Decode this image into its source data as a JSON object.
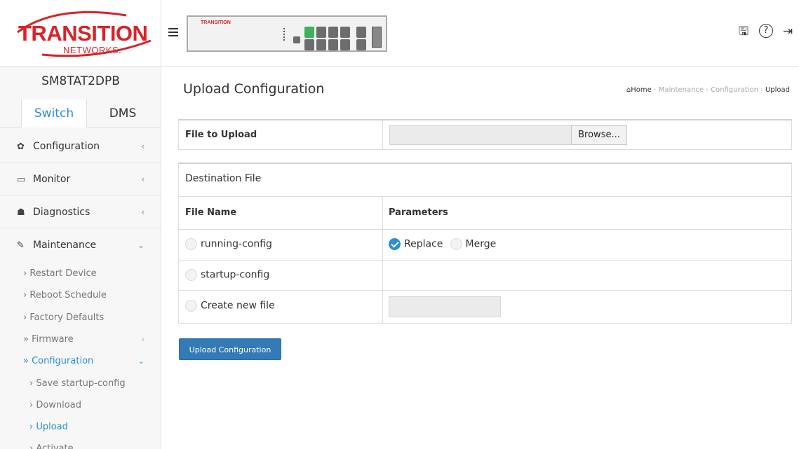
{
  "brand": {
    "logo_main": "TRANSITION",
    "logo_sub": "NETWORKS.",
    "panel_brand": "TRANSITION",
    "accent": "#d8232a"
  },
  "device_name": "SM8TAT2DPB",
  "tabs": [
    {
      "label": "Switch",
      "active": true
    },
    {
      "label": "DMS",
      "active": false
    }
  ],
  "nav": {
    "configuration": {
      "label": "Configuration",
      "icon": "gear-icon"
    },
    "monitor": {
      "label": "Monitor",
      "icon": "monitor-icon"
    },
    "diagnostics": {
      "label": "Diagnostics",
      "icon": "sitemap-icon"
    },
    "maintenance": {
      "label": "Maintenance",
      "icon": "wrench-icon"
    },
    "sub": [
      {
        "label": "Restart Device"
      },
      {
        "label": "Reboot Schedule"
      },
      {
        "label": "Factory Defaults"
      },
      {
        "label": "Firmware"
      },
      {
        "label": "Configuration"
      },
      {
        "label": "Save startup-config"
      },
      {
        "label": "Download"
      },
      {
        "label": "Upload"
      },
      {
        "label": "Activate"
      }
    ]
  },
  "topbar_icons": [
    "save-icon",
    "help-icon",
    "logout-icon"
  ],
  "page": {
    "title": "Upload Configuration",
    "breadcrumb": [
      "Home",
      "Maintenance",
      "Configuration",
      "Upload"
    ]
  },
  "upload": {
    "label": "File to Upload",
    "browse_label": "Browse...",
    "file_value": ""
  },
  "destination": {
    "title": "Destination File",
    "col_file": "File Name",
    "col_params": "Parameters",
    "files": [
      {
        "label": "running-config",
        "selected": false
      },
      {
        "label": "startup-config",
        "selected": false
      },
      {
        "label": "Create new file",
        "selected": false
      }
    ],
    "params": [
      {
        "label": "Replace",
        "selected": true
      },
      {
        "label": "Merge",
        "selected": false
      }
    ],
    "new_file_value": ""
  },
  "submit_label": "Upload Configuration",
  "colors": {
    "primary": "#337ab7",
    "link": "#2a8fd7"
  }
}
